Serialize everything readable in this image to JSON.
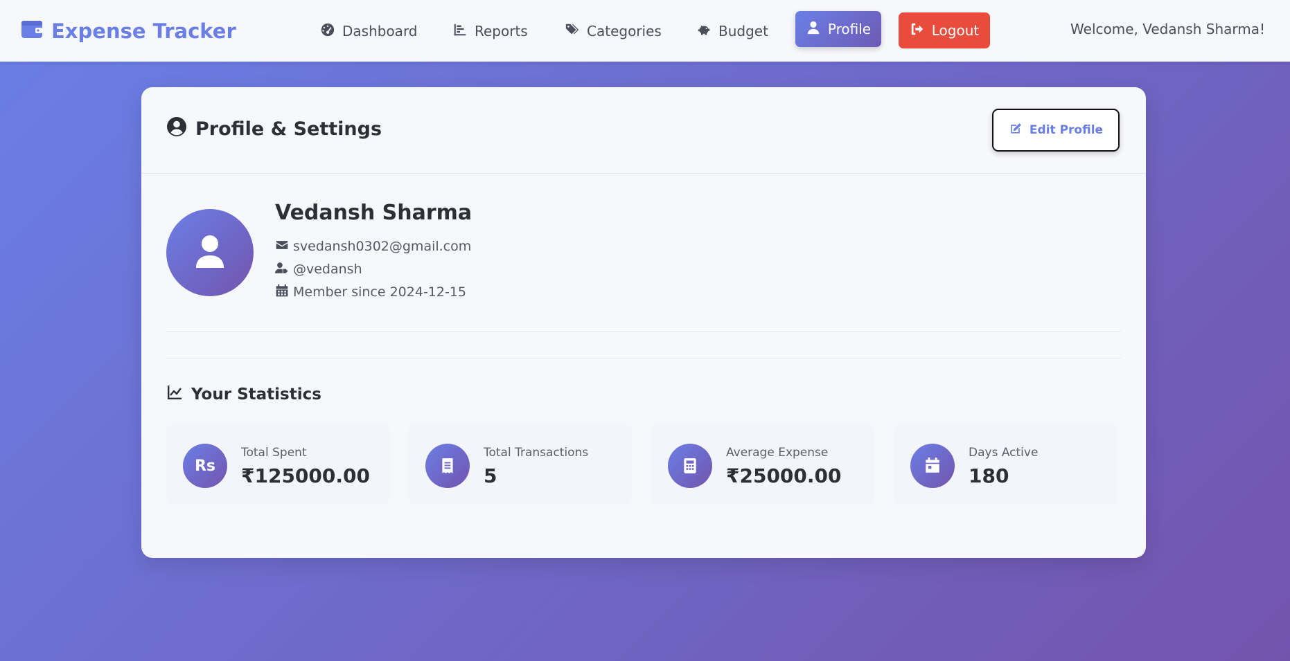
{
  "brand": {
    "title": "Expense Tracker",
    "icon": "wallet-icon",
    "color": "#6a7fe6"
  },
  "nav": {
    "links": [
      {
        "label": "Dashboard",
        "icon": "tachometer-icon"
      },
      {
        "label": "Reports",
        "icon": "bar-chart-icon"
      },
      {
        "label": "Categories",
        "icon": "tags-icon"
      },
      {
        "label": "Budget",
        "icon": "piggy-bank-icon"
      }
    ],
    "profile_label": "Profile",
    "logout_label": "Logout",
    "welcome": "Welcome, Vedansh Sharma!"
  },
  "card": {
    "title": "Profile & Settings",
    "edit_label": "Edit Profile"
  },
  "user": {
    "name": "Vedansh Sharma",
    "email": "svedansh0302@gmail.com",
    "username": "@vedansh",
    "member_since": "Member since 2024-12-15"
  },
  "stats": {
    "title": "Your Statistics",
    "items": [
      {
        "label": "Total Spent",
        "value": "₹125000.00",
        "icon": "rupee-icon",
        "icon_text": "Rs"
      },
      {
        "label": "Total Transactions",
        "value": "5",
        "icon": "receipt-icon"
      },
      {
        "label": "Average Expense",
        "value": "₹25000.00",
        "icon": "calculator-icon"
      },
      {
        "label": "Days Active",
        "value": "180",
        "icon": "calendar-icon"
      }
    ]
  },
  "colors": {
    "accent": "#6a7fe6",
    "accent_dark": "#7354ad",
    "logout": "#e74c3c"
  }
}
